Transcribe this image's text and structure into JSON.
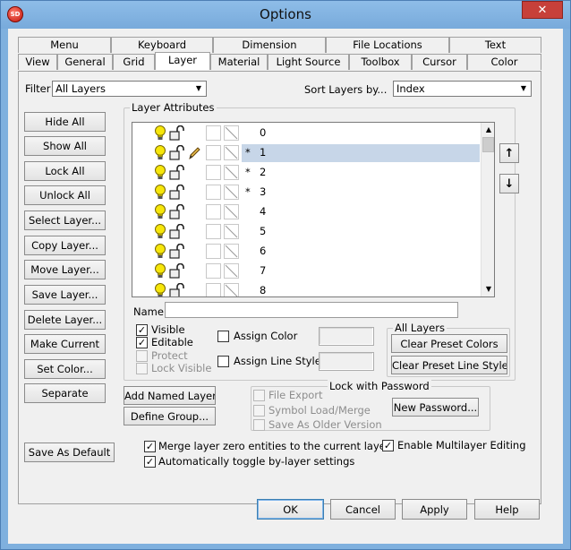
{
  "window": {
    "title": "Options",
    "app_icon_text": "SD",
    "close_glyph": "✕"
  },
  "tabs_back": [
    "Menu",
    "Keyboard",
    "Dimension",
    "File Locations",
    "Text"
  ],
  "tabs_front": [
    "View",
    "General",
    "Grid",
    "Layer",
    "Material",
    "Light Source",
    "Toolbox",
    "Cursor",
    "Color"
  ],
  "active_tab": "Layer",
  "filter": {
    "label": "Filter",
    "value": "All Layers"
  },
  "sort": {
    "label": "Sort Layers by...",
    "value": "Index"
  },
  "left_buttons": [
    "Hide All",
    "Show All",
    "Lock All",
    "Unlock All",
    "Select Layer...",
    "Copy Layer...",
    "Move Layer...",
    "Save Layer...",
    "Delete Layer...",
    "Make Current",
    "Set Color...",
    "Separate"
  ],
  "layer_attributes": {
    "title": "Layer Attributes",
    "layers": [
      {
        "name": "0",
        "star": "",
        "selected": false,
        "pen": false
      },
      {
        "name": "1",
        "star": "*",
        "selected": true,
        "pen": true
      },
      {
        "name": "2",
        "star": "*",
        "selected": false,
        "pen": false
      },
      {
        "name": "3",
        "star": "*",
        "selected": false,
        "pen": false
      },
      {
        "name": "4",
        "star": "",
        "selected": false,
        "pen": false
      },
      {
        "name": "5",
        "star": "",
        "selected": false,
        "pen": false
      },
      {
        "name": "6",
        "star": "",
        "selected": false,
        "pen": false
      },
      {
        "name": "7",
        "star": "",
        "selected": false,
        "pen": false
      },
      {
        "name": "8",
        "star": "",
        "selected": false,
        "pen": false
      }
    ],
    "name_label": "Name:",
    "name_value": ""
  },
  "checkboxes_left": [
    {
      "label": "Visible",
      "checked": true,
      "enabled": true
    },
    {
      "label": "Editable",
      "checked": true,
      "enabled": true
    },
    {
      "label": "Protect",
      "checked": false,
      "enabled": false
    },
    {
      "label": "Lock Visible",
      "checked": false,
      "enabled": false
    }
  ],
  "assign": {
    "color": "Assign Color",
    "line_style": "Assign Line Style"
  },
  "all_layers": {
    "title": "All Layers",
    "clear_colors": "Clear Preset Colors",
    "clear_line_styles": "Clear Preset Line Styles"
  },
  "named": {
    "add": "Add Named Layer...",
    "define": "Define Group..."
  },
  "lock_password": {
    "title": "Lock with Password",
    "options": [
      "File Export",
      "Symbol Load/Merge",
      "Save As Older Version"
    ],
    "new_password": "New Password..."
  },
  "save_default": "Save As Default",
  "bottom_checks": [
    {
      "label": "Merge layer zero entities to the current layer",
      "checked": true
    },
    {
      "label": "Automatically toggle by-layer settings",
      "checked": true
    },
    {
      "label": "Enable Multilayer Editing",
      "checked": true
    }
  ],
  "dialog_buttons": {
    "ok": "OK",
    "cancel": "Cancel",
    "apply": "Apply",
    "help": "Help"
  },
  "move_up_glyph": "↑",
  "move_down_glyph": "↓",
  "check_glyph": "✓",
  "colors": {
    "title_bar": "#7fb0de",
    "close": "#c7403a",
    "selection": "#c7d6e8",
    "bulb": "#f6e60a"
  }
}
